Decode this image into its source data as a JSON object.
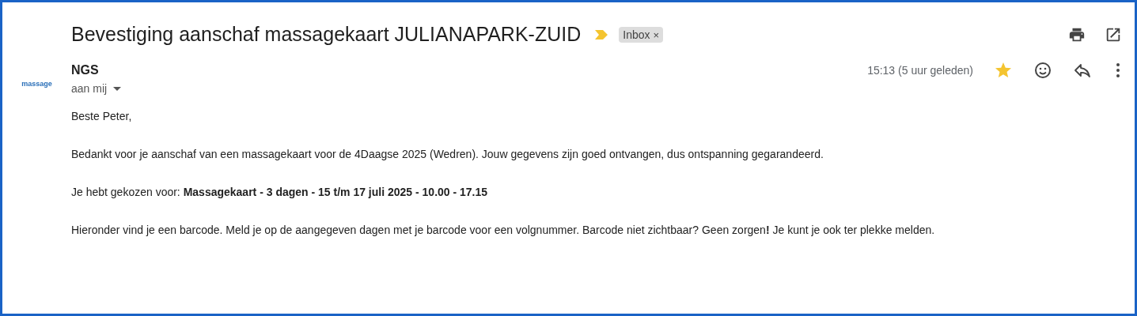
{
  "subject": "Bevestiging aanschaf massagekaart JULIANAPARK-ZUID",
  "important": true,
  "label": {
    "text": "Inbox",
    "close": "×"
  },
  "sender": {
    "logo_text": "massage",
    "name": "NGS",
    "recipient": "aan mij"
  },
  "time": "15:13 (5 uur geleden)",
  "starred": true,
  "body": [
    "Beste Peter,",
    "Bedankt voor je aanschaf van een massagekaart voor de 4Daagse 2025 (Wedren). Jouw gegevens zijn goed ontvangen, dus ontspanning gegarandeerd.",
    "Je hebt gekozen voor: **Massagekaart - 3 dagen - 15 t/m 17 juli 2025 - 10.00 - 17.15**",
    "Hieronder vind je een barcode. Meld je op de aangegeven dagen met je barcode voor een volgnummer. Barcode niet zichtbaar? Geen zorgen**!** Je kunt je ook ter plekke melden."
  ]
}
